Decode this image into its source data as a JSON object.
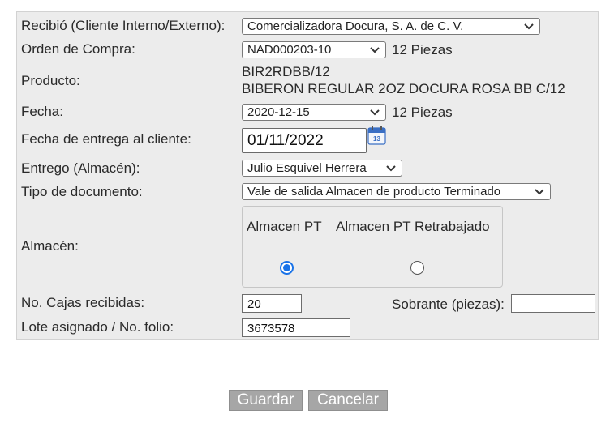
{
  "form": {
    "recibio_label": "Recibió (Cliente Interno/Externo):",
    "recibio_value": "Comercializadora Docura, S. A. de C. V.",
    "orden_label": "Orden de Compra:",
    "orden_value": "NAD000203-10",
    "orden_piezas": "12 Piezas",
    "producto_label": "Producto:",
    "producto_code": "BIR2RDBB/12",
    "producto_desc": "BIBERON REGULAR 2OZ DOCURA ROSA BB C/12",
    "fecha_label": "Fecha:",
    "fecha_value": "2020-12-15",
    "fecha_piezas": "12 Piezas",
    "entrega_label": "Fecha de entrega al cliente:",
    "entrega_value": "01/11/2022",
    "calendar_day": "13",
    "entrego_label": "Entrego (Almacén):",
    "entrego_value": "Julio Esquivel Herrera",
    "tipo_label": "Tipo de documento:",
    "tipo_value": "Vale de salida Almacen de producto Terminado",
    "almacen_label": "Almacén:",
    "almacen_options": [
      {
        "label": "Almacen PT",
        "selected": true
      },
      {
        "label": "Almacen PT Retrabajado",
        "selected": false
      }
    ],
    "cajas_label": "No. Cajas recibidas:",
    "cajas_value": "20",
    "sobrante_label": "Sobrante (piezas):",
    "sobrante_value": "",
    "lote_label": "Lote asignado / No. folio:",
    "lote_value": "3673578"
  },
  "actions": {
    "save_label": "Guardar",
    "cancel_label": "Cancelar"
  },
  "colors": {
    "panel_bg": "#ececec",
    "button_bg": "#a6a6a6",
    "radio_accent": "#1a73e8",
    "calendar_icon": "#3a6fc4"
  }
}
